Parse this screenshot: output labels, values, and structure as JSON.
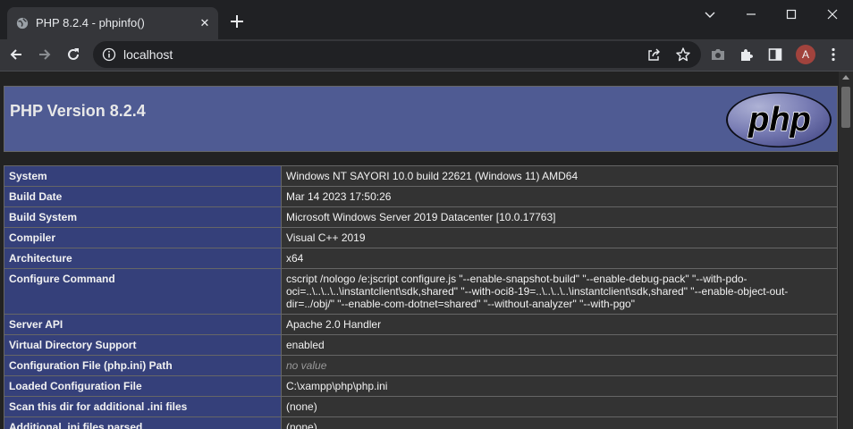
{
  "browser": {
    "tab_title": "PHP 8.2.4 - phpinfo()",
    "url": "localhost",
    "profile_initial": "A",
    "icons": [
      "globe-icon",
      "close-icon",
      "plus-icon",
      "chevron-down-icon",
      "minimize-icon",
      "maximize-icon",
      "close-window-icon",
      "back-arrow-icon",
      "forward-arrow-icon",
      "reload-icon",
      "info-icon",
      "share-icon",
      "star-icon",
      "camera-icon",
      "puzzle-extension-icon",
      "side-panel-icon",
      "more-vert-icon"
    ]
  },
  "page": {
    "title": "PHP Version 8.2.4",
    "logo_text": "php",
    "colors": {
      "header_bg": "#4f5b93",
      "label_bg": "#35407a",
      "value_bg": "#333333"
    },
    "rows": [
      {
        "label": "System",
        "value": "Windows NT SAYORI 10.0 build 22621 (Windows 11) AMD64"
      },
      {
        "label": "Build Date",
        "value": "Mar 14 2023 17:50:26"
      },
      {
        "label": "Build System",
        "value": "Microsoft Windows Server 2019 Datacenter [10.0.17763]"
      },
      {
        "label": "Compiler",
        "value": "Visual C++ 2019"
      },
      {
        "label": "Architecture",
        "value": "x64"
      },
      {
        "label": "Configure Command",
        "value": "cscript /nologo /e:jscript configure.js \"--enable-snapshot-build\" \"--enable-debug-pack\" \"--with-pdo-oci=..\\..\\..\\..\\instantclient\\sdk,shared\" \"--with-oci8-19=..\\..\\..\\..\\instantclient\\sdk,shared\" \"--enable-object-out-dir=../obj/\" \"--enable-com-dotnet=shared\" \"--without-analyzer\" \"--with-pgo\""
      },
      {
        "label": "Server API",
        "value": "Apache 2.0 Handler"
      },
      {
        "label": "Virtual Directory Support",
        "value": "enabled"
      },
      {
        "label": "Configuration File (php.ini) Path",
        "value": "no value"
      },
      {
        "label": "Loaded Configuration File",
        "value": "C:\\xampp\\php\\php.ini"
      },
      {
        "label": "Scan this dir for additional .ini files",
        "value": "(none)"
      },
      {
        "label": "Additional .ini files parsed",
        "value": "(none)"
      }
    ]
  }
}
